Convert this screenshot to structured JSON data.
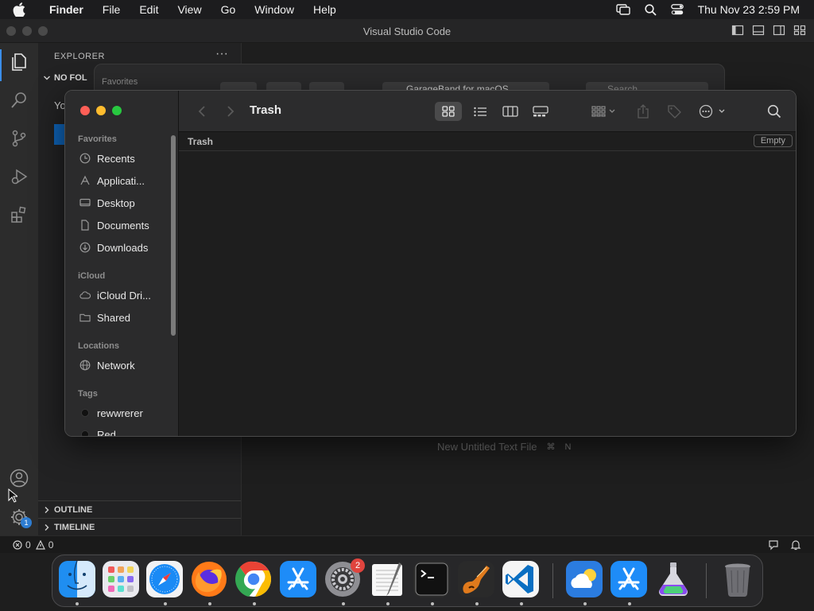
{
  "menubar": {
    "items": [
      "Finder",
      "File",
      "Edit",
      "View",
      "Go",
      "Window",
      "Help"
    ],
    "clock": "Thu Nov 23  2:59 PM"
  },
  "vscode": {
    "window_title": "Visual Studio Code",
    "explorer_label": "EXPLORER",
    "more_label": "···",
    "folder_label": "NO FOL",
    "welcome_text": "Yo",
    "outline_label": "OUTLINE",
    "timeline_label": "TIMELINE",
    "settings_badge": "1",
    "hint_text": "New Untitled Text File",
    "hint_key1": "⌘",
    "hint_key2": "N",
    "status_errors": "0",
    "status_warnings": "0"
  },
  "background_finder": {
    "favorites_label": "Favorites",
    "location_popup": "GarageBand for macOS",
    "search_placeholder": "Search"
  },
  "finder": {
    "title": "Trash",
    "path_label": "Trash",
    "empty_button": "Empty",
    "sections": {
      "favorites": "Favorites",
      "icloud": "iCloud",
      "locations": "Locations",
      "tags": "Tags"
    },
    "favorites": [
      {
        "label": "Recents",
        "icon": "clock-icon"
      },
      {
        "label": "Applicati...",
        "icon": "applications-icon"
      },
      {
        "label": "Desktop",
        "icon": "desktop-icon"
      },
      {
        "label": "Documents",
        "icon": "document-icon"
      },
      {
        "label": "Downloads",
        "icon": "download-icon"
      }
    ],
    "icloud": [
      {
        "label": "iCloud Dri...",
        "icon": "cloud-icon"
      },
      {
        "label": "Shared",
        "icon": "shared-folder-icon"
      }
    ],
    "locations": [
      {
        "label": "Network",
        "icon": "globe-icon"
      }
    ],
    "tags": [
      {
        "label": "rewwrerer",
        "color": "#111111"
      },
      {
        "label": "Red",
        "color": "#111111"
      }
    ]
  },
  "dock": {
    "apps": [
      "finder",
      "launchpad",
      "safari",
      "firefox",
      "chrome",
      "app-store",
      "system-settings",
      "textedit",
      "terminal",
      "garageband",
      "vscode",
      "weather",
      "app-store-2",
      "automator",
      "trash"
    ],
    "system_settings_badge": "2"
  },
  "colors": {
    "close": "#fe5f57",
    "minimize": "#febc2e",
    "zoom": "#28c840",
    "vscode_accent": "#0e63b7"
  }
}
